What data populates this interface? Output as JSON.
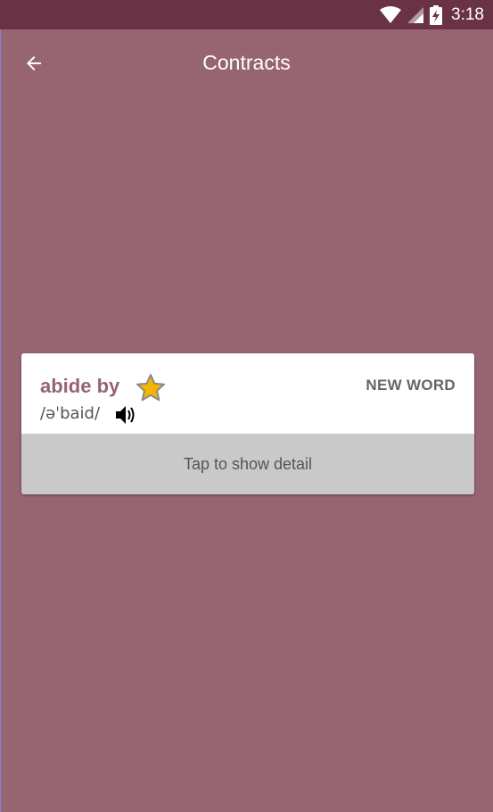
{
  "status_bar": {
    "time": "3:18",
    "icons": [
      "wifi-icon",
      "signal-icon",
      "battery-charging-icon"
    ]
  },
  "app_bar": {
    "title": "Contracts",
    "back_icon": "arrow-back-icon"
  },
  "card": {
    "word": "abide by",
    "phonetic": "/əˈbaid/",
    "badge": "NEW WORD",
    "star_icon": "star-icon",
    "speaker_icon": "speaker-icon",
    "tap_label": "Tap to show detail"
  },
  "colors": {
    "background": "#976572",
    "status_bar": "#6a3345",
    "word": "#956472",
    "tap_area": "#c9c9c9",
    "star": "#f5b400"
  }
}
